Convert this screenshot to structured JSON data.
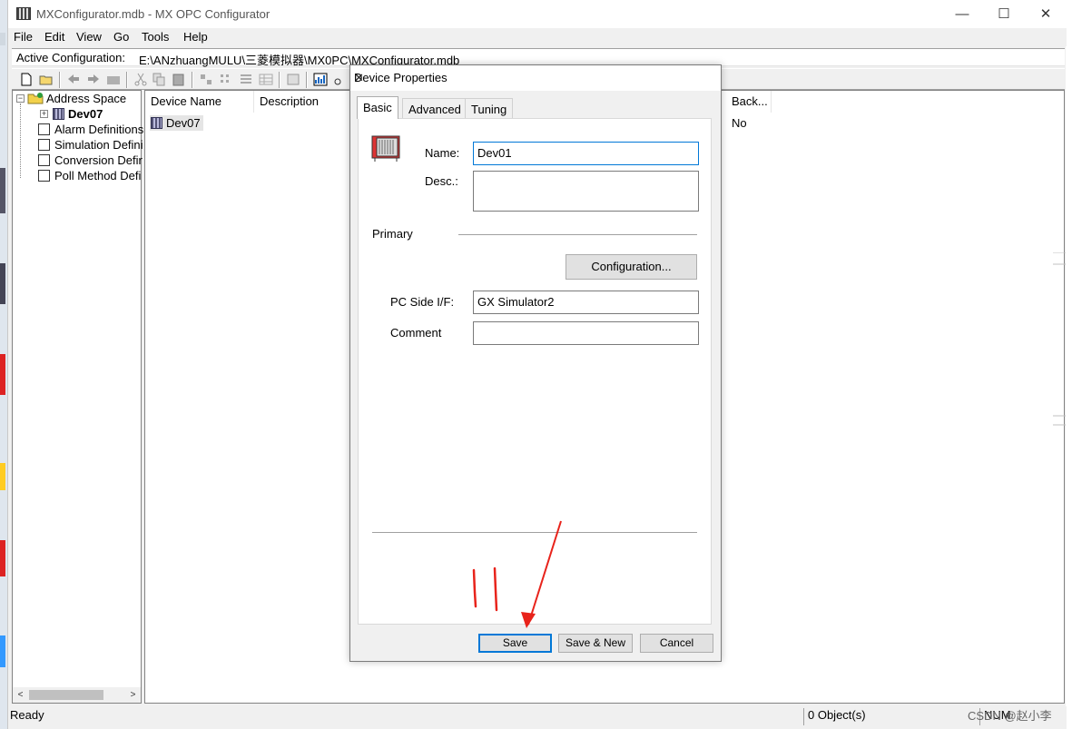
{
  "window": {
    "title": "MXConfigurator.mdb - MX OPC Configurator",
    "minimize": "—",
    "maximize": "☐",
    "close": "✕"
  },
  "menu": [
    "File",
    "Edit",
    "View",
    "Go",
    "Tools",
    "Help"
  ],
  "active_config": {
    "label": "Active Configuration:",
    "path": "E:\\ANzhuangMULU\\三菱模拟器\\MX0PC\\MXConfigurator.mdb"
  },
  "tree": {
    "root": "Address Space",
    "device": "Dev07",
    "items": [
      "Alarm Definitions",
      "Simulation Defini",
      "Conversion Defir",
      "Poll Method Defi"
    ]
  },
  "list": {
    "columns": [
      "Device Name",
      "Description",
      "Back..."
    ],
    "rows": [
      {
        "name": "Dev07",
        "back": "No"
      }
    ]
  },
  "status": {
    "left": "Ready",
    "objects": "0 Object(s)",
    "num": "NUM"
  },
  "dialog": {
    "title": "Device Properties",
    "tabs": [
      "Basic",
      "Advanced",
      "Tuning"
    ],
    "name_label": "Name:",
    "name_value": "Dev01",
    "desc_label": "Desc.:",
    "desc_value": "",
    "primary_label": "Primary",
    "config_button": "Configuration...",
    "pcside_label": "PC Side I/F:",
    "pcside_value": "GX Simulator2",
    "comment_label": "Comment",
    "comment_value": "",
    "save_button": "Save",
    "save_new_button": "Save & New",
    "cancel_button": "Cancel",
    "close": "✕"
  },
  "watermark": "CSDN @赵小李",
  "colors": {
    "accent": "#0078d7",
    "annotation": "#e8231b"
  }
}
